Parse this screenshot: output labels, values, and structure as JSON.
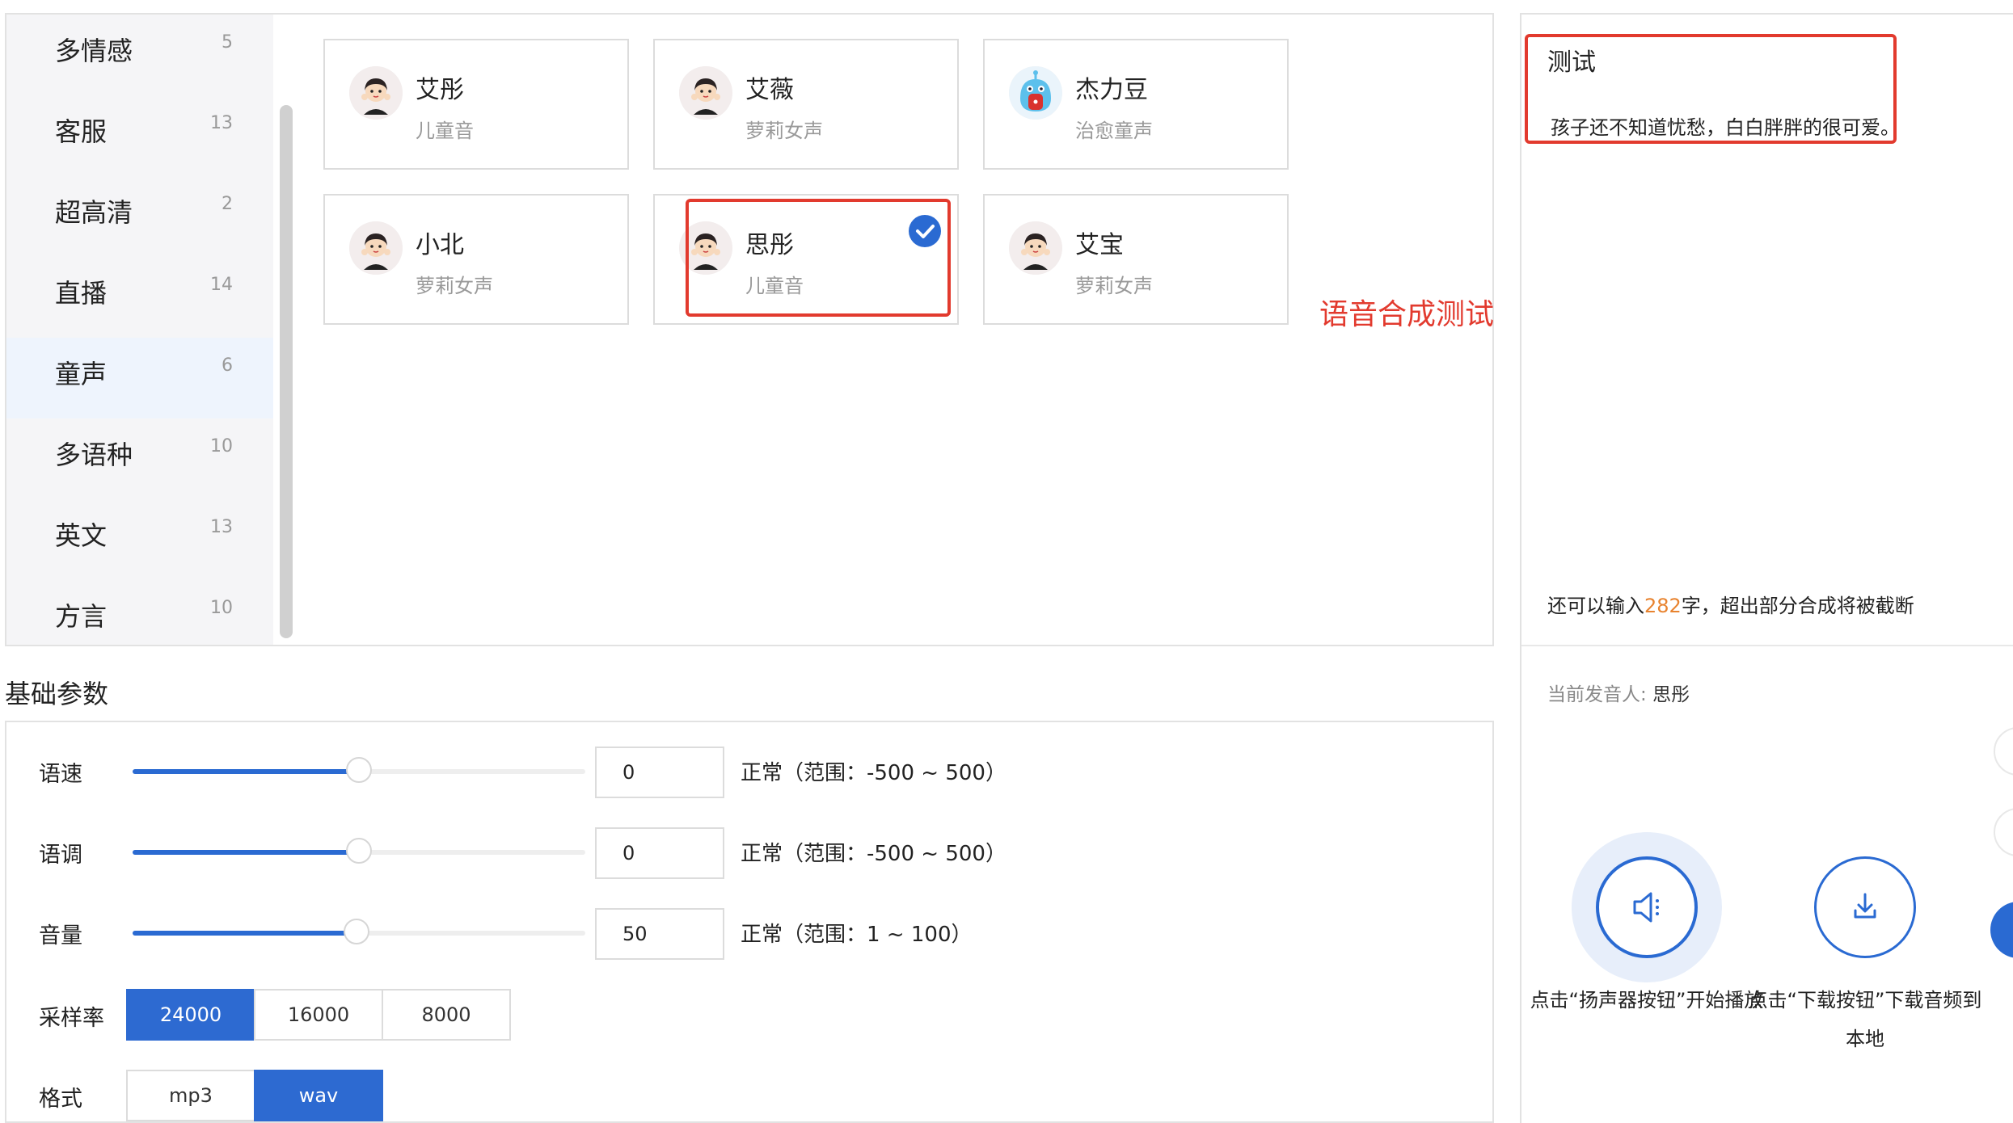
{
  "categories": [
    {
      "name": "多情感",
      "count": "5"
    },
    {
      "name": "客服",
      "count": "13"
    },
    {
      "name": "超高清",
      "count": "2"
    },
    {
      "name": "直播",
      "count": "14"
    },
    {
      "name": "童声",
      "count": "6"
    },
    {
      "name": "多语种",
      "count": "10"
    },
    {
      "name": "英文",
      "count": "13"
    },
    {
      "name": "方言",
      "count": "10"
    }
  ],
  "active_category": "童声",
  "voices": [
    {
      "name": "艾彤",
      "type": "儿童音"
    },
    {
      "name": "艾薇",
      "type": "萝莉女声"
    },
    {
      "name": "杰力豆",
      "type": "治愈童声"
    },
    {
      "name": "小北",
      "type": "萝莉女声"
    },
    {
      "name": "思彤",
      "type": "儿童音"
    },
    {
      "name": "艾宝",
      "type": "萝莉女声"
    }
  ],
  "selected_voice": "思彤",
  "annotation": "语音合成测试",
  "text_input": {
    "title": "测试",
    "content": "孩子还不知道忧愁，白白胖胖的很可爱。"
  },
  "remaining": {
    "prefix": "还可以输入",
    "count": "282",
    "suffix": "字，超出部分合成将被截断"
  },
  "current_speaker": {
    "label": "当前发音人: ",
    "name": "思彤"
  },
  "actions": {
    "play_caption": "点击“扬声器按钮”开始播放",
    "download_caption": "点击“下载按钮”下载音频到本地"
  },
  "params": {
    "heading": "基础参数",
    "speed": {
      "label": "语速",
      "value": "0",
      "level": 0.5,
      "range": "正常（范围：-500 ~ 500）"
    },
    "pitch": {
      "label": "语调",
      "value": "0",
      "level": 0.5,
      "range": "正常（范围：-500 ~ 500）"
    },
    "volume": {
      "label": "音量",
      "value": "50",
      "level": 0.495,
      "range": "正常（范围：1 ~ 100）"
    },
    "sample_rate": {
      "label": "采样率",
      "options": [
        "24000",
        "16000",
        "8000"
      ],
      "selected": "24000"
    },
    "format": {
      "label": "格式",
      "options": [
        "mp3",
        "wav"
      ],
      "selected": "wav"
    }
  },
  "colors": {
    "accent": "#2a6ad2",
    "annotation_red": "#e23a2e",
    "count_orange": "#e8832f"
  }
}
